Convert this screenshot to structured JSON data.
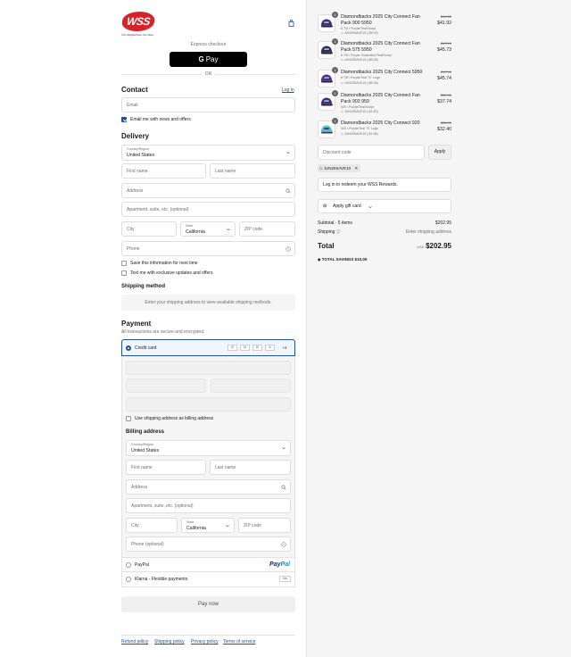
{
  "brand": {
    "logo_text": "WSS",
    "tagline": "Your Neighborhood. Your Store.",
    "accent": "#d6232a",
    "link_color": "#1f4fa0"
  },
  "express": {
    "title": "Express checkout",
    "gpay_label": "Pay",
    "or": "OR"
  },
  "contact": {
    "title": "Contact",
    "login": "Log in",
    "email_placeholder": "Email",
    "news_label": "Email me with news and offers"
  },
  "delivery": {
    "title": "Delivery",
    "country_label": "Country/Region",
    "country_value": "United States",
    "first_name": "First name",
    "last_name": "Last name",
    "address": "Address",
    "apartment": "Apartment, suite, etc. (optional)",
    "city": "City",
    "state_label": "State",
    "state_value": "California",
    "zip": "ZIP code",
    "phone": "Phone",
    "save_info": "Save this information for next time",
    "text_me": "Text me with exclusive updates and offers"
  },
  "shipping_method": {
    "title": "Shipping method",
    "notice": "Enter your shipping address to view available shipping methods."
  },
  "payment": {
    "title": "Payment",
    "subtitle": "All transactions are secure and encrypted.",
    "credit_card": "Credit card",
    "card_brands": [
      "VI",
      "M",
      "DI",
      "A"
    ],
    "more_brands": "+4",
    "use_shipping": "Use shipping address as billing address",
    "paypal_label": "PayPal",
    "paypal_logo_a": "Pay",
    "paypal_logo_b": "Pal",
    "klarna_label": "Klarna - Flexible payments",
    "klarna_logo": "kla"
  },
  "billing": {
    "title": "Billing address",
    "country_label": "Country/Region",
    "country_value": "United States",
    "first_name": "First name",
    "last_name": "Last name",
    "address": "Address",
    "apartment": "Apartment, suite, etc. (optional)",
    "city": "City",
    "state_label": "State",
    "state_value": "California",
    "zip": "ZIP code",
    "phone": "Phone (optional)"
  },
  "pay_now": "Pay now",
  "footer": [
    "Refund policy",
    "Shipping policy",
    "Privacy policy",
    "Terms of service"
  ],
  "cart": {
    "items": [
      {
        "qty": "1",
        "name": "Diamondbacks 2025 City Connect Fan Pack 900 5950",
        "variant": "6 7/8 / Purple/Teal/Script",
        "discount": "JUN25SAVE10 (-$5.09)",
        "original": "$41.95",
        "price": "$41.92"
      },
      {
        "qty": "1",
        "name": "Diamondbacks 2025 City Connect Fan Pack 575 5950",
        "variant": "6 7/8 / Purple Snakeskin/Teal/Script",
        "discount": "JUN25SAVE10 (-$5.08)",
        "original": "$47.99",
        "price": "$45.73"
      },
      {
        "qty": "1",
        "name": "Diamondbacks 2025 City Connect 5950",
        "variant": "6 7/8 / Purple/Teal \"S\" Logo",
        "discount": "JUN25SAVE10 (-$5.08)",
        "original": "$47.99",
        "price": "$45.74"
      },
      {
        "qty": "1",
        "name": "Diamondbacks 2025 City Connect Fan Pack 903 950",
        "variant": "N/S / Purple/Teal/Script",
        "discount": "JUN25SAVE10 (-$1.83)",
        "original": "$39.99",
        "price": "$37.74"
      },
      {
        "qty": "1",
        "name": "Diamondbacks 2025 City Connect 920",
        "variant": "N/S / Purple/Teal \"S\" Logo",
        "discount": "JUN25SAVE10 (-$1.88)",
        "original": "$33.99",
        "price": "$32.40"
      }
    ],
    "discount_placeholder": "Discount code",
    "apply": "Apply",
    "applied_code": "JUN25SAVE10",
    "rewards": "Log in to redeem your WSS Rewards.",
    "gift_card": "Apply gift card",
    "subtotal_label": "Subtotal · 5 items",
    "subtotal_value": "$202.95",
    "shipping_label": "Shipping",
    "shipping_value": "Enter shipping address",
    "total_label": "Total",
    "currency": "USD",
    "total_value": "$202.95",
    "savings_label": "TOTAL SAVINGS",
    "savings_value": "$10.00"
  }
}
